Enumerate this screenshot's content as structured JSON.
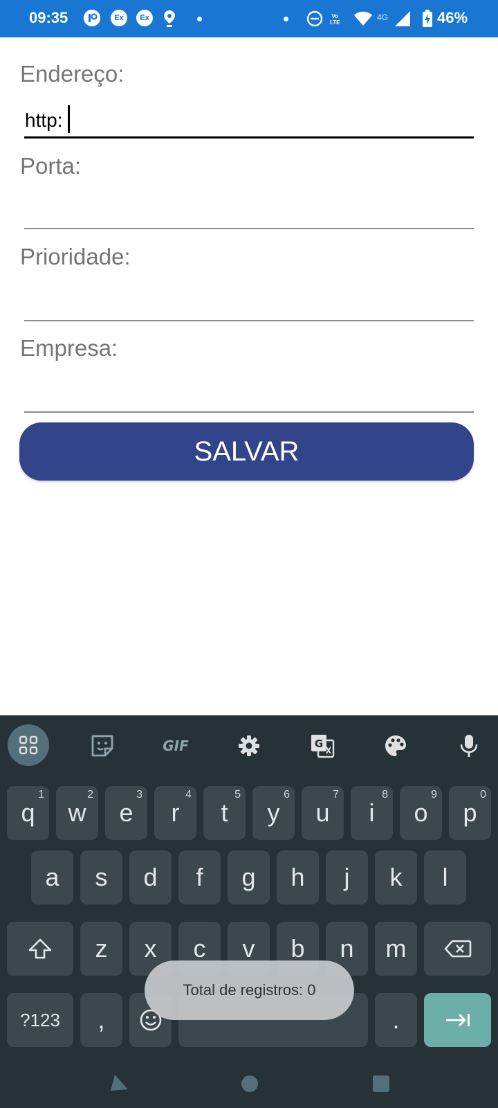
{
  "status_bar": {
    "time": "09:35",
    "badges": [
      "Ex",
      "Ex"
    ],
    "network_label": "4G",
    "volte_label_top": "Vo",
    "volte_label_bottom": "LTE",
    "battery": "46%"
  },
  "form": {
    "fields": [
      {
        "label": "Endereço:",
        "value": "http:"
      },
      {
        "label": "Porta:",
        "value": ""
      },
      {
        "label": "Prioridade:",
        "value": ""
      },
      {
        "label": "Empresa:",
        "value": ""
      }
    ],
    "save_label": "SALVAR"
  },
  "keyboard": {
    "toolbar": [
      "apps-grid-icon",
      "sticker-icon",
      "gif-icon",
      "gear-icon",
      "translate-icon",
      "palette-icon",
      "microphone-icon"
    ],
    "gif_label": "GIF",
    "row1": [
      "q",
      "w",
      "e",
      "r",
      "t",
      "y",
      "u",
      "i",
      "o",
      "p"
    ],
    "row1_hints": [
      "1",
      "2",
      "3",
      "4",
      "5",
      "6",
      "7",
      "8",
      "9",
      "0"
    ],
    "row2": [
      "a",
      "s",
      "d",
      "f",
      "g",
      "h",
      "j",
      "k",
      "l"
    ],
    "row3": [
      "z",
      "x",
      "c",
      "v",
      "b",
      "n",
      "m"
    ],
    "symbols_label": "?123",
    "comma_label": ",",
    "period_label": ".",
    "accent_color": "#6bafa8"
  },
  "toast": {
    "text": "Total de registros: 0"
  },
  "colors": {
    "status_bar": "#1976d2",
    "button": "#32458a",
    "keyboard_bg": "#263238",
    "key_bg": "#3c474e"
  }
}
